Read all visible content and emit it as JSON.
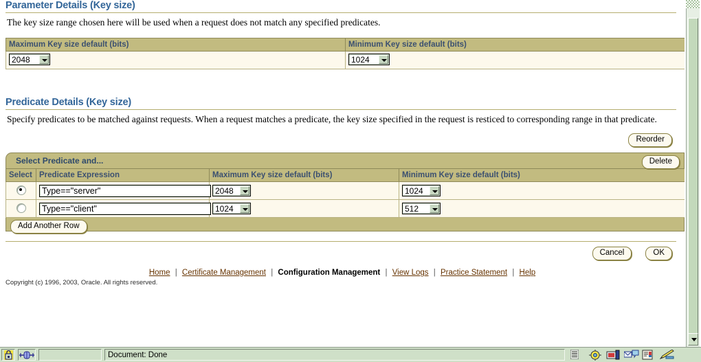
{
  "parameter_section": {
    "title": "Parameter Details (Key size)",
    "description": "The key size range chosen here will be used when a request does not match any specified predicates.",
    "columns": [
      "Maximum Key size default (bits)",
      "Minimum Key size default (bits)"
    ],
    "max_value": "2048",
    "min_value": "1024"
  },
  "predicate_section": {
    "title": "Predicate Details (Key size)",
    "description": "Specify predicates to be matched against requests. When a request matches a predicate, the key size specified in the request is resticed to corresponding range in that predicate.",
    "reorder_label": "Reorder",
    "band_title": "Select Predicate and...",
    "delete_label": "Delete",
    "add_row_label": "Add Another Row",
    "columns": [
      "Select",
      "Predicate Expression",
      "Maximum Key size default (bits)",
      "Minimum Key size default (bits)"
    ],
    "rows": [
      {
        "selected": true,
        "expression": "Type==\"server\"",
        "max": "2048",
        "min": "1024"
      },
      {
        "selected": false,
        "expression": "Type==\"client\"",
        "max": "1024",
        "min": "512"
      }
    ]
  },
  "actions": {
    "cancel_label": "Cancel",
    "ok_label": "OK"
  },
  "footer": {
    "links": [
      {
        "label": "Home",
        "current": false
      },
      {
        "label": "Certificate Management",
        "current": false
      },
      {
        "label": "Configuration Management",
        "current": true
      },
      {
        "label": "View Logs",
        "current": false
      },
      {
        "label": "Practice Statement",
        "current": false
      },
      {
        "label": "Help",
        "current": false
      }
    ],
    "separator": "|",
    "copyright": "Copyright (c) 1996, 2003, Oracle. All rights reserved."
  },
  "statusbar": {
    "document_status": "Document: Done"
  },
  "colors": {
    "header_band": "#c2bb80",
    "row_bg": "#fdf9ec",
    "heading_text": "#336699",
    "table_header_text": "#3b5070",
    "link": "#663300",
    "chrome_green": "#cfe0c8"
  }
}
